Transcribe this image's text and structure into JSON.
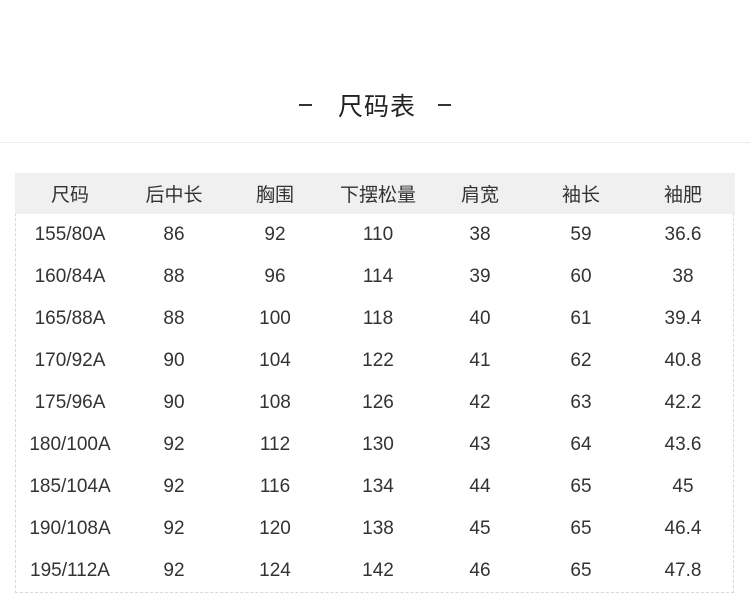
{
  "title": "尺码表",
  "headers": [
    "尺码",
    "后中长",
    "胸围",
    "下摆松量",
    "肩宽",
    "袖长",
    "袖肥"
  ],
  "rows": [
    [
      "155/80A",
      "86",
      "92",
      "110",
      "38",
      "59",
      "36.6"
    ],
    [
      "160/84A",
      "88",
      "96",
      "114",
      "39",
      "60",
      "38"
    ],
    [
      "165/88A",
      "88",
      "100",
      "118",
      "40",
      "61",
      "39.4"
    ],
    [
      "170/92A",
      "90",
      "104",
      "122",
      "41",
      "62",
      "40.8"
    ],
    [
      "175/96A",
      "90",
      "108",
      "126",
      "42",
      "63",
      "42.2"
    ],
    [
      "180/100A",
      "92",
      "112",
      "130",
      "43",
      "64",
      "43.6"
    ],
    [
      "185/104A",
      "92",
      "116",
      "134",
      "44",
      "65",
      "45"
    ],
    [
      "190/108A",
      "92",
      "120",
      "138",
      "45",
      "65",
      "46.4"
    ],
    [
      "195/112A",
      "92",
      "124",
      "142",
      "46",
      "65",
      "47.8"
    ]
  ]
}
